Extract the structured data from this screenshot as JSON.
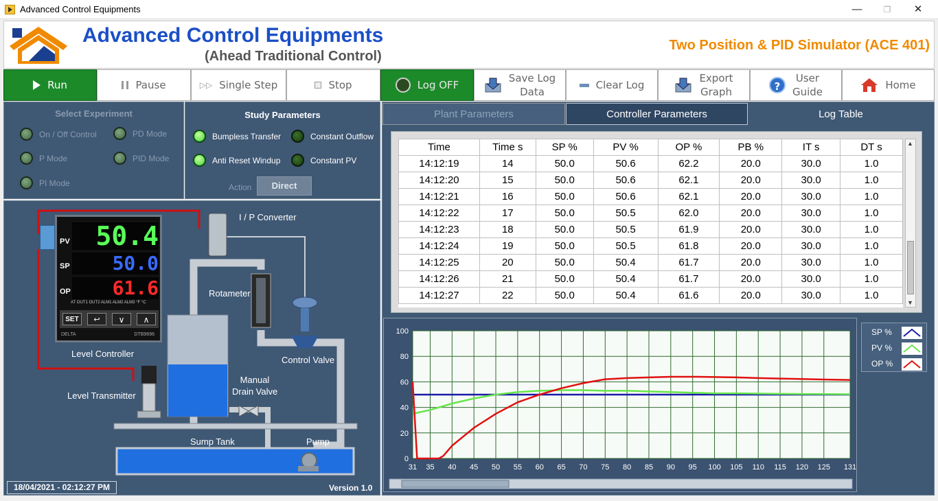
{
  "window": {
    "title": "Advanced Control Equipments",
    "minimize": "—",
    "restore": "❐",
    "close": "✕"
  },
  "header": {
    "brand": "Advanced Control Equipments",
    "subtitle": "(Ahead Traditional Control)",
    "simulator": "Two Position & PID Simulator (ACE 401)"
  },
  "toolbar": [
    {
      "label": "Run",
      "icon": "play-icon"
    },
    {
      "label": "Pause",
      "icon": "pause-icon"
    },
    {
      "label": "Single Step",
      "icon": "step-icon"
    },
    {
      "label": "Stop",
      "icon": "stop-icon"
    },
    {
      "label": "Log OFF",
      "icon": "power-icon"
    },
    {
      "label_line1": "Save Log",
      "label_line2": "Data",
      "icon": "save-icon"
    },
    {
      "label": "Clear Log",
      "icon": "clear-icon"
    },
    {
      "label_line1": "Export",
      "label_line2": "Graph",
      "icon": "export-icon"
    },
    {
      "label_line1": "User",
      "label_line2": "Guide",
      "icon": "help-icon"
    },
    {
      "label": "Home",
      "icon": "home-icon"
    }
  ],
  "experiment": {
    "title": "Select Experiment",
    "options": [
      "On / Off Control",
      "PD Mode",
      "P Mode",
      "PID Mode",
      "PI Mode"
    ]
  },
  "study": {
    "title": "Study Parameters",
    "options": [
      "Bumpless Transfer",
      "Constant Outflow",
      "Anti Reset Windup",
      "Constant PV"
    ],
    "action_label": "Action",
    "action_value": "Direct"
  },
  "process": {
    "ip_converter": "I / P Converter",
    "rotameter": "Rotameter",
    "control_valve": "Control Valve",
    "level_controller": "Level Controller",
    "level_transmitter": "Level Transmitter",
    "manual_drain_line1": "Manual",
    "manual_drain_line2": "Drain Valve",
    "sump_tank": "Sump Tank",
    "pump": "Pump",
    "pv_label": "PV",
    "sp_label": "SP",
    "op_label": "OP",
    "pv_value": "50.4",
    "sp_value": "50.0",
    "op_value": "61.6",
    "keys": [
      "SET",
      "↩",
      "∨",
      "∧"
    ],
    "status_leds": "AT OUT1 OUT2 ALM1 ALM2 ALM3   °F  °C",
    "maker": "DELTA",
    "model": "DTB9696"
  },
  "footer": {
    "datetime": "18/04/2021 - 02:12:27 PM",
    "version": "Version 1.0"
  },
  "tabs": [
    "Plant Parameters",
    "Controller Parameters",
    "Log Table"
  ],
  "log": {
    "columns": [
      "Time",
      "Time s",
      "SP %",
      "PV %",
      "OP %",
      "PB %",
      "IT s",
      "DT s"
    ],
    "rows": [
      [
        "14:12:19",
        "14",
        "50.0",
        "50.6",
        "62.2",
        "20.0",
        "30.0",
        "1.0"
      ],
      [
        "14:12:20",
        "15",
        "50.0",
        "50.6",
        "62.1",
        "20.0",
        "30.0",
        "1.0"
      ],
      [
        "14:12:21",
        "16",
        "50.0",
        "50.6",
        "62.1",
        "20.0",
        "30.0",
        "1.0"
      ],
      [
        "14:12:22",
        "17",
        "50.0",
        "50.5",
        "62.0",
        "20.0",
        "30.0",
        "1.0"
      ],
      [
        "14:12:23",
        "18",
        "50.0",
        "50.5",
        "61.9",
        "20.0",
        "30.0",
        "1.0"
      ],
      [
        "14:12:24",
        "19",
        "50.0",
        "50.5",
        "61.8",
        "20.0",
        "30.0",
        "1.0"
      ],
      [
        "14:12:25",
        "20",
        "50.0",
        "50.4",
        "61.7",
        "20.0",
        "30.0",
        "1.0"
      ],
      [
        "14:12:26",
        "21",
        "50.0",
        "50.4",
        "61.7",
        "20.0",
        "30.0",
        "1.0"
      ],
      [
        "14:12:27",
        "22",
        "50.0",
        "50.4",
        "61.6",
        "20.0",
        "30.0",
        "1.0"
      ]
    ]
  },
  "chart_data": {
    "type": "line",
    "xlim": [
      31,
      131
    ],
    "ylim": [
      0,
      100
    ],
    "x_ticks": [
      31,
      35,
      40,
      45,
      50,
      55,
      60,
      65,
      70,
      75,
      80,
      85,
      90,
      95,
      100,
      105,
      110,
      115,
      120,
      125,
      131
    ],
    "y_ticks": [
      0,
      20,
      40,
      60,
      80,
      100
    ],
    "grid": true,
    "legend_position": "right",
    "series": [
      {
        "name": "SP %",
        "color": "#1a1aa8",
        "x": [
          31,
          131
        ],
        "y": [
          50,
          50
        ]
      },
      {
        "name": "PV %",
        "color": "#66e64a",
        "x": [
          31,
          35,
          40,
          45,
          50,
          55,
          60,
          65,
          70,
          75,
          80,
          85,
          90,
          95,
          100,
          105,
          110,
          115,
          120,
          125,
          131
        ],
        "y": [
          35,
          38,
          43,
          47,
          50,
          52,
          53,
          53.5,
          53.5,
          53,
          53,
          52.5,
          52,
          51.5,
          51,
          51,
          50.8,
          50.6,
          50.5,
          50.4,
          50.3
        ]
      },
      {
        "name": "OP %",
        "color": "#e01010",
        "x": [
          31,
          32,
          37,
          38,
          40,
          45,
          50,
          55,
          60,
          65,
          70,
          75,
          80,
          85,
          90,
          95,
          100,
          105,
          110,
          115,
          120,
          125,
          131
        ],
        "y": [
          60,
          0,
          0,
          2,
          10,
          24,
          35,
          44,
          50,
          55,
          59,
          62,
          63,
          63.5,
          64,
          64,
          63.8,
          63.5,
          63,
          62.6,
          62.2,
          61.8,
          61.5
        ]
      }
    ]
  }
}
